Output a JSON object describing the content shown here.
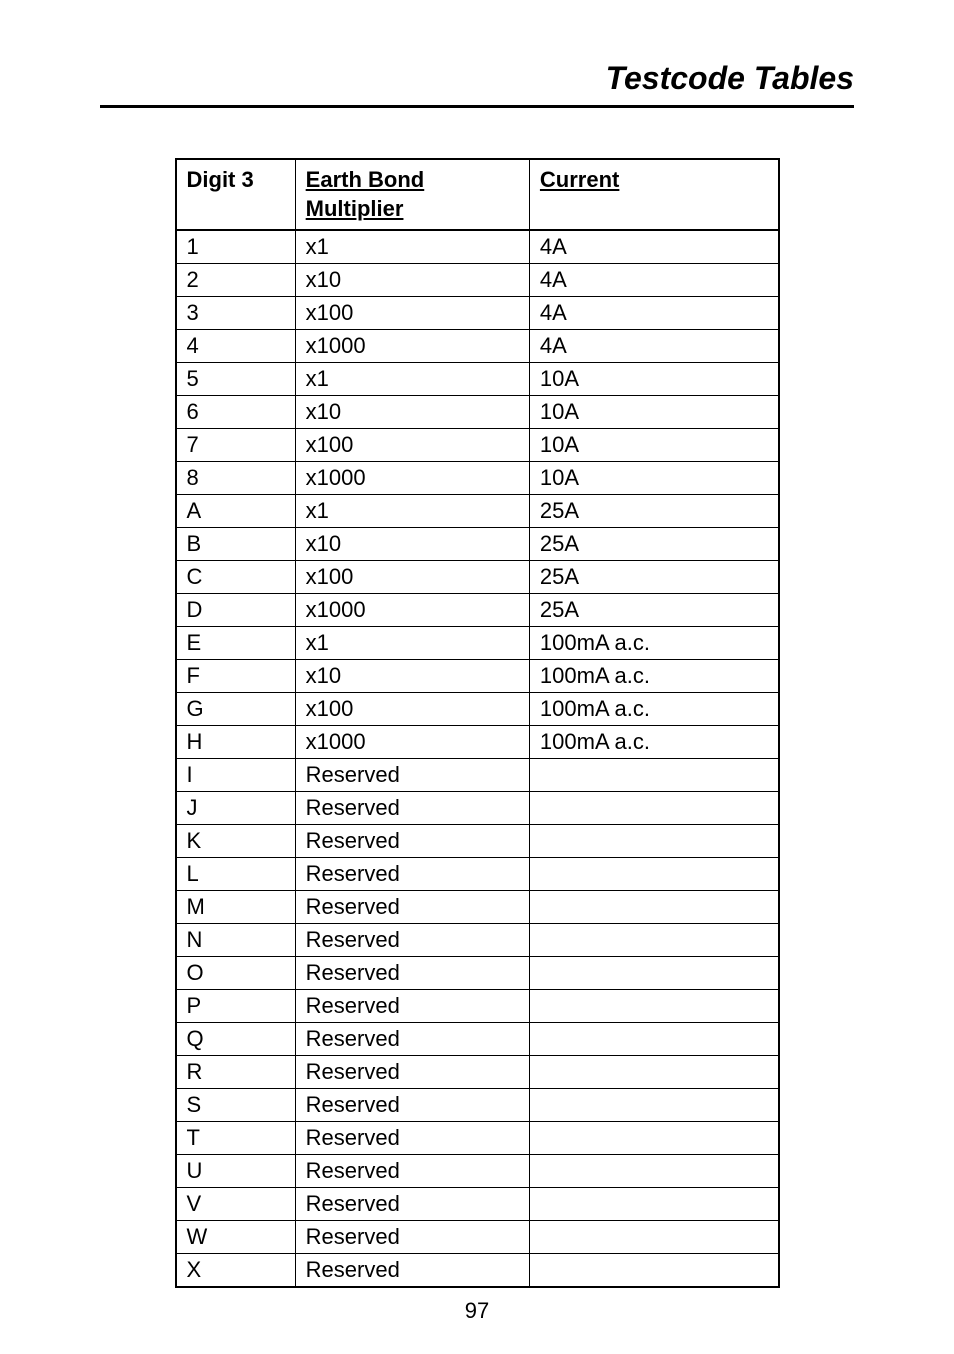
{
  "header": {
    "title": "Testcode Tables"
  },
  "table": {
    "headers": {
      "digit": "Digit 3",
      "multiplier": "Earth Bond Multiplier",
      "current": "Current"
    },
    "rows": [
      {
        "digit": "1",
        "multiplier": "x1",
        "current": "4A"
      },
      {
        "digit": "2",
        "multiplier": "x10",
        "current": "4A"
      },
      {
        "digit": "3",
        "multiplier": "x100",
        "current": "4A"
      },
      {
        "digit": "4",
        "multiplier": "x1000",
        "current": "4A"
      },
      {
        "digit": "5",
        "multiplier": "x1",
        "current": "10A"
      },
      {
        "digit": "6",
        "multiplier": "x10",
        "current": "10A"
      },
      {
        "digit": "7",
        "multiplier": "x100",
        "current": "10A"
      },
      {
        "digit": "8",
        "multiplier": "x1000",
        "current": "10A"
      },
      {
        "digit": "A",
        "multiplier": "x1",
        "current": "25A"
      },
      {
        "digit": "B",
        "multiplier": "x10",
        "current": "25A"
      },
      {
        "digit": "C",
        "multiplier": "x100",
        "current": "25A"
      },
      {
        "digit": "D",
        "multiplier": "x1000",
        "current": "25A"
      },
      {
        "digit": "E",
        "multiplier": "x1",
        "current": "100mA a.c."
      },
      {
        "digit": "F",
        "multiplier": "x10",
        "current": "100mA a.c."
      },
      {
        "digit": "G",
        "multiplier": "x100",
        "current": "100mA a.c."
      },
      {
        "digit": "H",
        "multiplier": "x1000",
        "current": "100mA a.c."
      },
      {
        "digit": "I",
        "multiplier": "Reserved",
        "current": ""
      },
      {
        "digit": "J",
        "multiplier": "Reserved",
        "current": ""
      },
      {
        "digit": "K",
        "multiplier": "Reserved",
        "current": ""
      },
      {
        "digit": "L",
        "multiplier": "Reserved",
        "current": ""
      },
      {
        "digit": "M",
        "multiplier": "Reserved",
        "current": ""
      },
      {
        "digit": "N",
        "multiplier": "Reserved",
        "current": ""
      },
      {
        "digit": "O",
        "multiplier": "Reserved",
        "current": ""
      },
      {
        "digit": "P",
        "multiplier": "Reserved",
        "current": ""
      },
      {
        "digit": "Q",
        "multiplier": "Reserved",
        "current": ""
      },
      {
        "digit": "R",
        "multiplier": "Reserved",
        "current": ""
      },
      {
        "digit": "S",
        "multiplier": "Reserved",
        "current": ""
      },
      {
        "digit": "T",
        "multiplier": "Reserved",
        "current": ""
      },
      {
        "digit": "U",
        "multiplier": "Reserved",
        "current": ""
      },
      {
        "digit": "V",
        "multiplier": "Reserved",
        "current": ""
      },
      {
        "digit": "W",
        "multiplier": "Reserved",
        "current": ""
      },
      {
        "digit": "X",
        "multiplier": "Reserved",
        "current": ""
      }
    ]
  },
  "page_number": "97"
}
